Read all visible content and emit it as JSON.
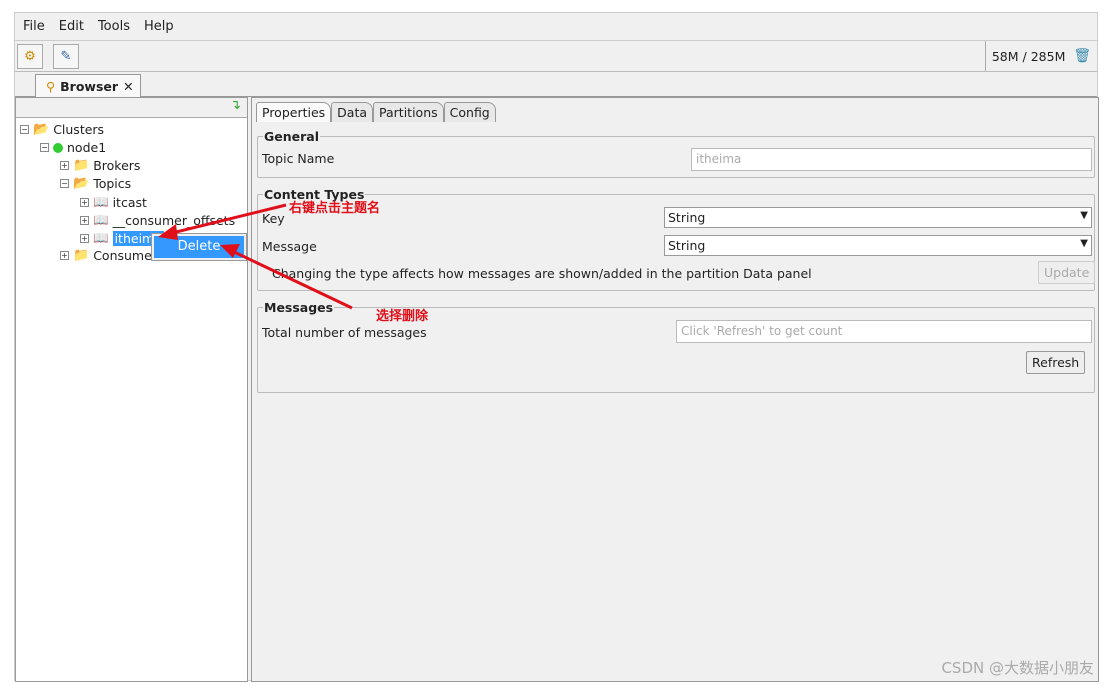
{
  "menu": [
    "File",
    "Edit",
    "Tools",
    "Help"
  ],
  "memory": "58M / 285M",
  "tab": {
    "label": "Browser",
    "close": "✕"
  },
  "tree": {
    "root": "Clusters",
    "cluster": "node1",
    "brokers": "Brokers",
    "topics": "Topics",
    "topic_items": [
      "itcast",
      "__consumer_offsets",
      "itheima"
    ],
    "consumers": "Consumers"
  },
  "context_menu": {
    "delete": "Delete"
  },
  "tabs": [
    "Properties",
    "Data",
    "Partitions",
    "Config"
  ],
  "general": {
    "title": "General",
    "topic_name_label": "Topic Name",
    "topic_name_value": "itheima"
  },
  "content_types": {
    "title": "Content Types",
    "key_label": "Key",
    "key_value": "String",
    "message_label": "Message",
    "message_value": "String",
    "note": "Changing the type affects how messages are shown/added in the partition Data panel",
    "update": "Update"
  },
  "messages": {
    "title": "Messages",
    "total_label": "Total number of messages",
    "placeholder": "Click 'Refresh' to get count",
    "refresh": "Refresh"
  },
  "annotations": {
    "right_click": "右键点击主题名",
    "select_delete": "选择删除"
  },
  "watermark": "CSDN @大数据小朋友"
}
